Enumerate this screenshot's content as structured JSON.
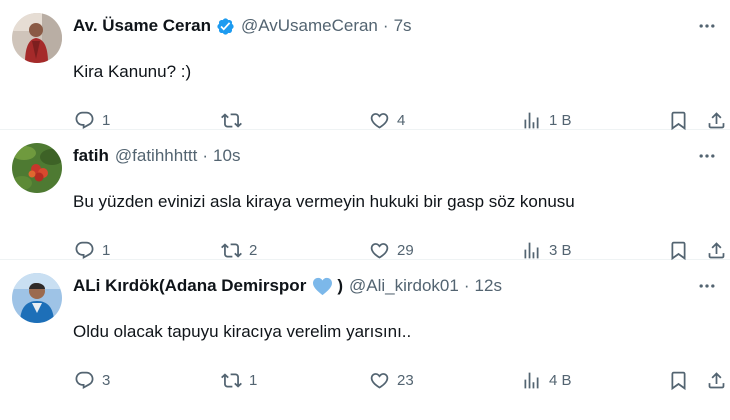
{
  "colors": {
    "text": "#0f1419",
    "muted": "#536471",
    "verified": "#1d9bf0",
    "divider": "#eff3f4",
    "heart_emoji": "#7cb8ea"
  },
  "tweets": [
    {
      "name": "Av. Üsame Ceran",
      "verified": true,
      "handle": "@AvUsameCeran",
      "separator": "·",
      "time": "7s",
      "text": "Kira Kanunu? :)",
      "replies": "1",
      "retweets": "",
      "likes": "4",
      "views": "1 B"
    },
    {
      "name": "fatih",
      "verified": false,
      "handle": "@fatihhhttt",
      "separator": "·",
      "time": "10s",
      "text": "Bu yüzden evinizi asla kiraya vermeyin hukuki bir gasp söz konusu",
      "replies": "1",
      "retweets": "2",
      "likes": "29",
      "views": "3 B"
    },
    {
      "name": "ALi Kırdök(Adana Demirspor",
      "name_suffix": ")",
      "name_emoji": "blue-heart-icon",
      "verified": false,
      "handle": "@Ali_kirdok01",
      "separator": "·",
      "time": "12s",
      "text": "Oldu olacak tapuyu kiracıya verelim yarısını..",
      "replies": "3",
      "retweets": "1",
      "likes": "23",
      "views": "4 B"
    }
  ]
}
